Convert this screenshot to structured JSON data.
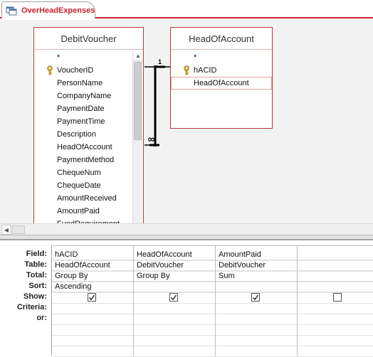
{
  "tab": {
    "label": "OverHeadExpenses",
    "icon": "query-icon"
  },
  "colors": {
    "accent": "#c8252c",
    "table_border": "#b83b3b"
  },
  "tables": [
    {
      "title": "DebitVoucher",
      "fields": [
        "*",
        "VoucherID",
        "PersonName",
        "CompanyName",
        "PaymentDate",
        "PaymentTime",
        "Description",
        "HeadOfAccount",
        "PaymentMethod",
        "ChequeNum",
        "ChequeDate",
        "AmountReceived",
        "AmountPaid",
        "FundRequirement"
      ],
      "key_field": "VoucherID"
    },
    {
      "title": "HeadOfAccount",
      "fields": [
        "*",
        "hACID",
        "HeadOfAccount"
      ],
      "key_field": "hACID",
      "selected_field": "HeadOfAccount"
    }
  ],
  "relationship": {
    "one_label": "1",
    "many_label": "∞"
  },
  "qbe": {
    "row_labels": [
      "Field:",
      "Table:",
      "Total:",
      "Sort:",
      "Show:",
      "Criteria:",
      "or:"
    ],
    "columns": [
      {
        "field": "hACID",
        "table": "HeadOfAccount",
        "total": "Group By",
        "sort": "Ascending",
        "show": true
      },
      {
        "field": "HeadOfAccount",
        "table": "DebitVoucher",
        "total": "Group By",
        "sort": "",
        "show": true
      },
      {
        "field": "AmountPaid",
        "table": "DebitVoucher",
        "total": "Sum",
        "sort": "",
        "show": true
      },
      {
        "field": "",
        "table": "",
        "total": "",
        "sort": "",
        "show": false
      }
    ]
  }
}
